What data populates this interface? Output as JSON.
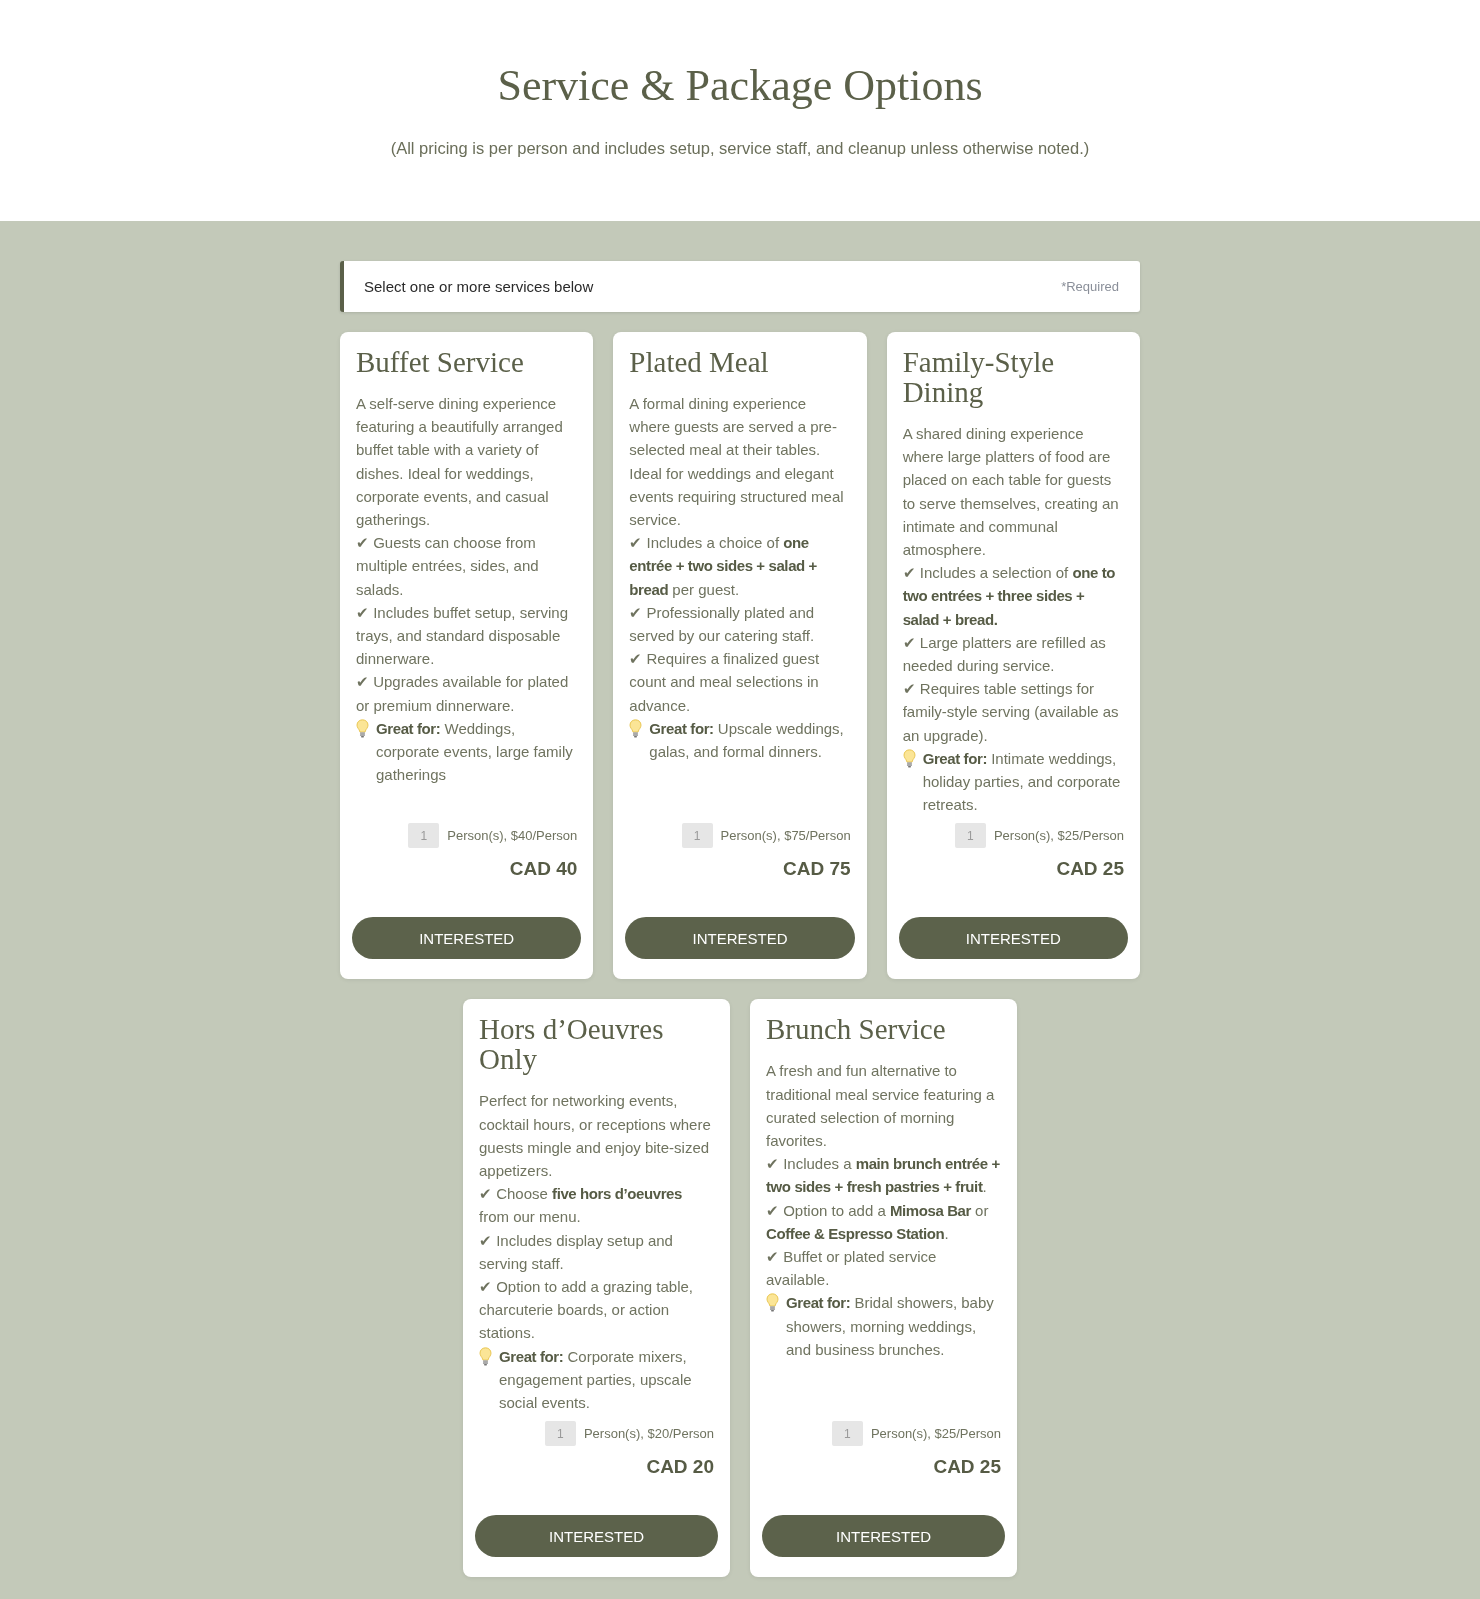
{
  "header": {
    "title": "Service & Package Options",
    "subtitle": "(All pricing is per person and includes setup, service staff, and cleanup unless otherwise noted.)"
  },
  "notice": {
    "label": "Select one or more services below",
    "required": "*Required"
  },
  "services": [
    {
      "title": "Buffet Service",
      "description": "A self-serve dining experience featuring a beautifully arranged buffet table with a variety of dishes. Ideal for weddings, corporate events, and casual gatherings.",
      "features": [
        "✔ Guests can choose from multiple entrées, sides, and salads.",
        "✔ Includes buffet setup, serving trays, and standard disposable dinnerware.",
        "✔ Upgrades available for plated or premium dinnerware."
      ],
      "great_for": "**Great for:** Weddings, corporate events, large family gatherings",
      "quantity": "1",
      "unit_label": "Person(s), $40/Person",
      "price": "CAD 40",
      "button": "INTERESTED"
    },
    {
      "title": "Plated Meal",
      "description": "A formal dining experience where guests are served a pre-selected meal at their tables. Ideal for weddings and elegant events requiring structured meal service.",
      "features": [
        "✔ Includes a choice of **one entrée + two sides + salad + bread** per guest.",
        "✔ Professionally plated and served by our catering staff.",
        "✔ Requires a finalized guest count and meal selections in advance."
      ],
      "great_for": "**Great for:** Upscale weddings, galas, and formal dinners.",
      "quantity": "1",
      "unit_label": "Person(s), $75/Person",
      "price": "CAD 75",
      "button": "INTERESTED"
    },
    {
      "title": "Family-Style Dining",
      "description": "A shared dining experience where large platters of food are placed on each table for guests to serve themselves, creating an intimate and communal atmosphere.",
      "features": [
        "✔ Includes a selection of **one to two entrées + three sides + salad + bread.**",
        "✔ Large platters are refilled as needed during service.",
        "✔ Requires table settings for family-style serving (available as an upgrade)."
      ],
      "great_for": "**Great for:** Intimate weddings, holiday parties, and corporate retreats.",
      "quantity": "1",
      "unit_label": "Person(s), $25/Person",
      "price": "CAD 25",
      "button": "INTERESTED"
    },
    {
      "title": "Hors d’Oeuvres Only",
      "description": "Perfect for networking events, cocktail hours, or receptions where guests mingle and enjoy bite-sized appetizers.",
      "features": [
        "✔ Choose **five hors d’oeuvres** from our menu.",
        "✔ Includes display setup and serving staff.",
        "✔ Option to add a grazing table, charcuterie boards, or action stations."
      ],
      "great_for": "**Great for:** Corporate mixers, engagement parties, upscale social events.",
      "quantity": "1",
      "unit_label": "Person(s), $20/Person",
      "price": "CAD 20",
      "button": "INTERESTED"
    },
    {
      "title": "Brunch Service",
      "description": "A fresh and fun alternative to traditional meal service featuring a curated selection of morning favorites.",
      "features": [
        "✔ Includes a **main brunch entrée + two sides + fresh pastries + fruit**.",
        "✔ Option to add a **Mimosa Bar** or **Coffee & Espresso Station**.",
        "✔ Buffet or plated service available."
      ],
      "great_for": "**Great for:** Bridal showers, baby showers, morning weddings, and business brunches.",
      "quantity": "1",
      "unit_label": "Person(s), $25/Person",
      "price": "CAD 25",
      "button": "INTERESTED"
    }
  ]
}
